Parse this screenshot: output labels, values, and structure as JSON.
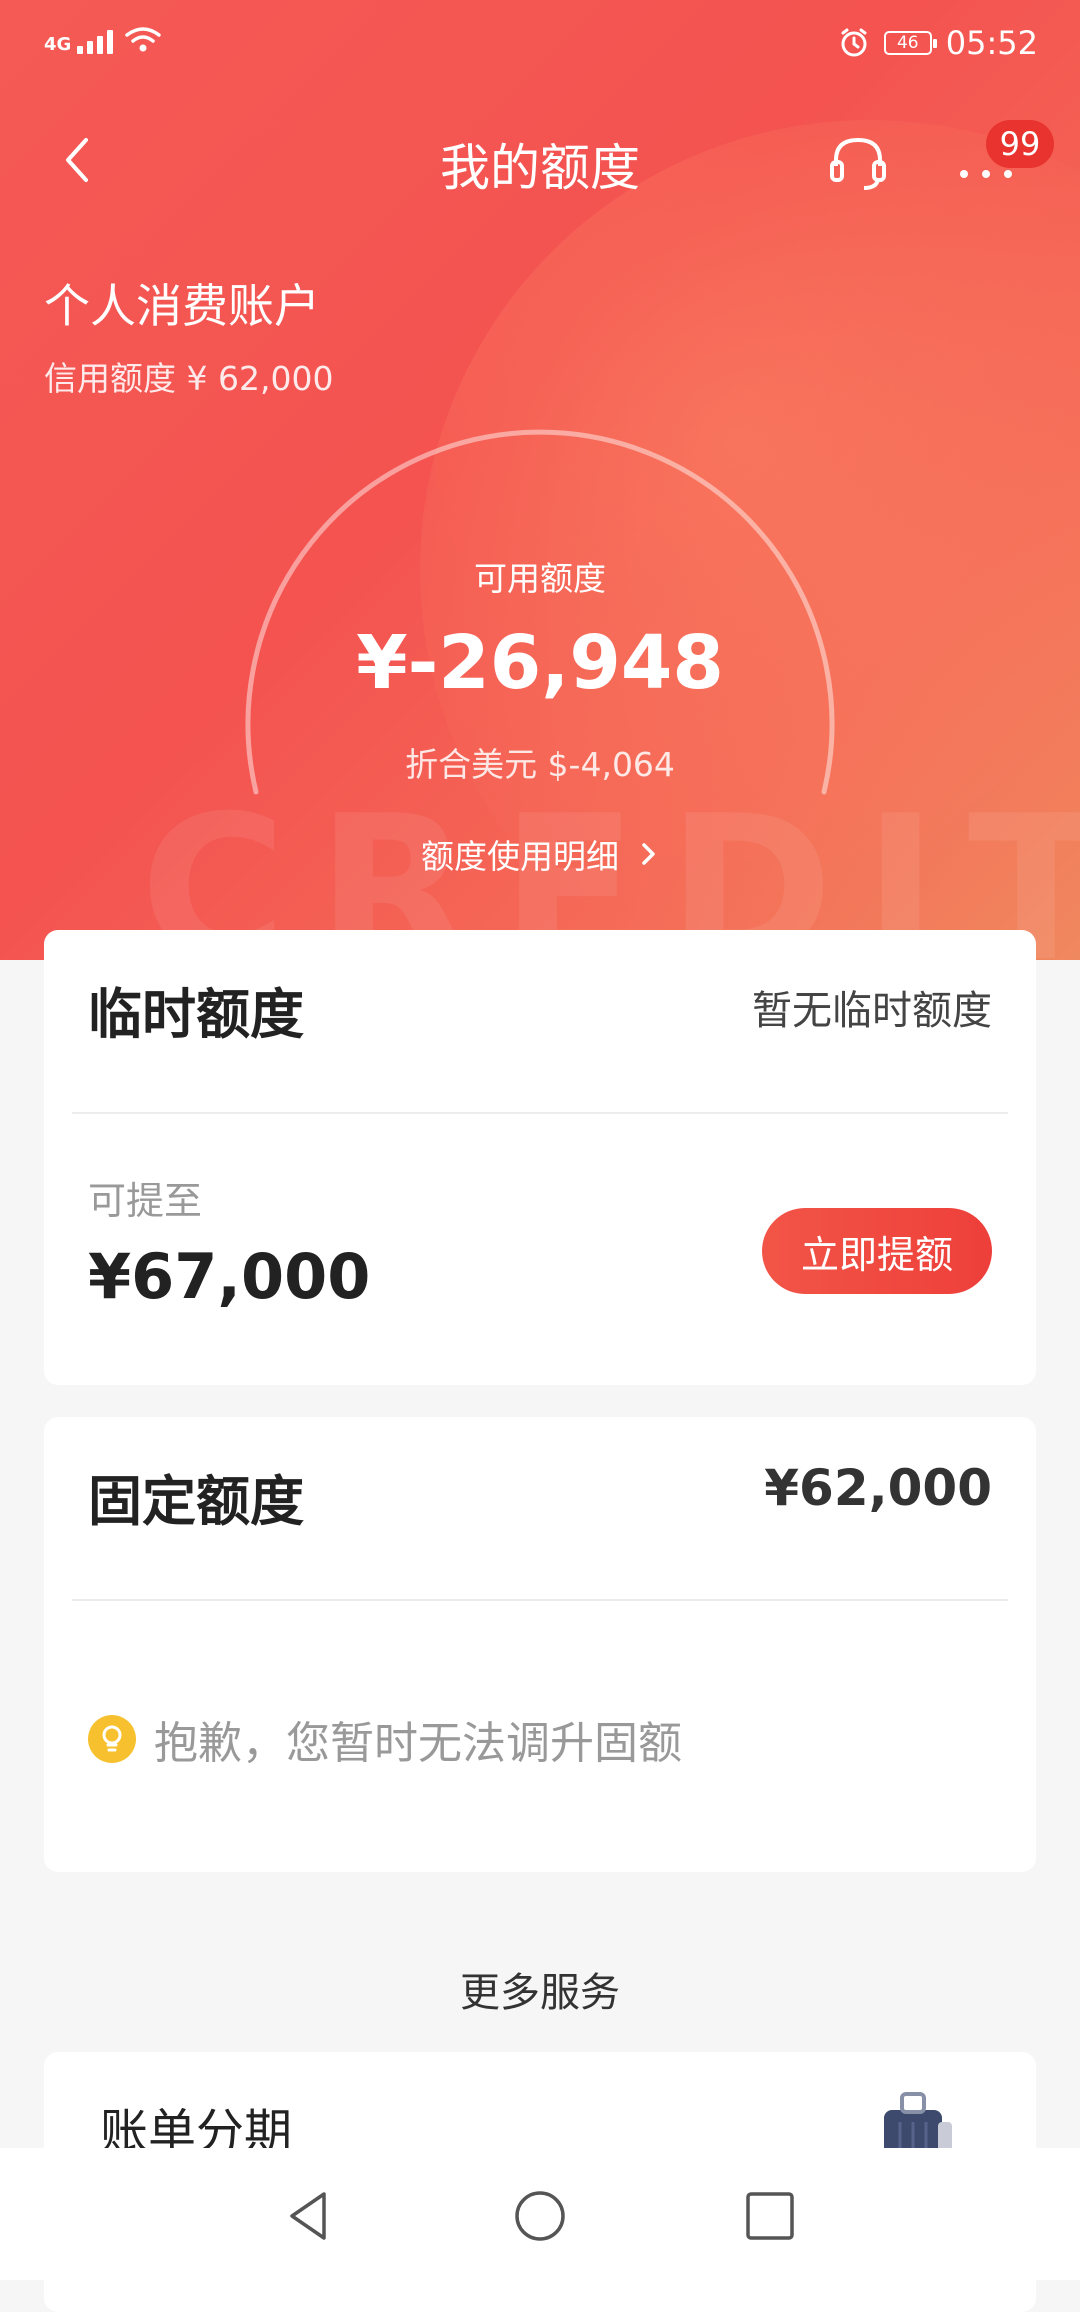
{
  "status_bar": {
    "network": "4G",
    "battery": "46",
    "time": "05:52"
  },
  "header": {
    "title": "我的额度",
    "more_badge": "99"
  },
  "account": {
    "title": "个人消费账户",
    "credit_limit": "信用额度 ¥ 62,000",
    "available_label": "可用额度",
    "available_amount": "¥-26,948",
    "usd_equiv": "折合美元 $-4,064",
    "detail_link": "额度使用明细",
    "watermark": "CREDIT"
  },
  "temp_limit": {
    "title": "临时额度",
    "status": "暂无临时额度",
    "can_raise_label": "可提至",
    "can_raise_amount": "¥67,000",
    "button": "立即提额"
  },
  "fixed_limit": {
    "title": "固定额度",
    "amount": "¥62,000",
    "notice": "抱歉，您暂时无法调升固额"
  },
  "more_services": {
    "title": "更多服务",
    "item": "账单分期"
  },
  "colors": {
    "accent": "#f4524f",
    "button": "#ee3f3a",
    "bulb": "#f7c02e"
  }
}
